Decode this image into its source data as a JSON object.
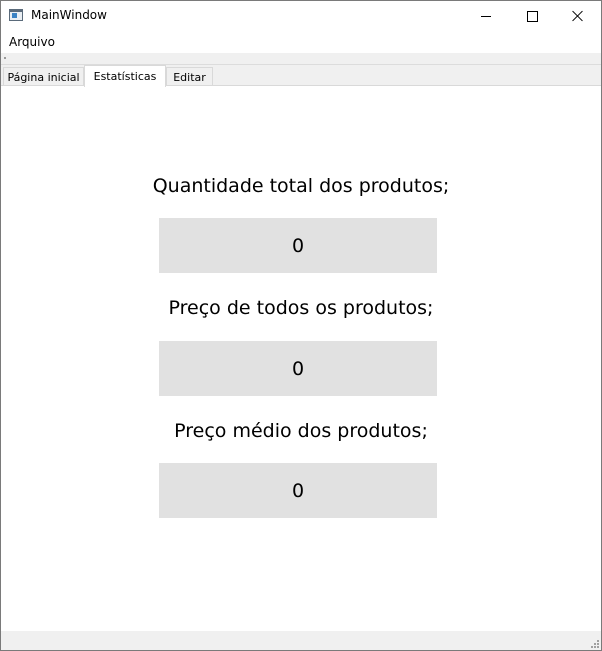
{
  "window": {
    "title": "MainWindow",
    "icon": "app-window-icon"
  },
  "menubar": {
    "items": [
      {
        "label": "Arquivo"
      }
    ]
  },
  "tabs": [
    {
      "label": "Página inicial",
      "active": false
    },
    {
      "label": "Estatísticas",
      "active": true
    },
    {
      "label": "Editar",
      "active": false
    }
  ],
  "stats": [
    {
      "label": "Quantidade total dos produtos;",
      "value": "0"
    },
    {
      "label": "Preço de todos os produtos;",
      "value": "0"
    },
    {
      "label": "Preço médio dos produtos;",
      "value": "0"
    }
  ],
  "colors": {
    "value_box_bg": "#e1e1e1",
    "chrome_bg": "#f0f0f0"
  }
}
